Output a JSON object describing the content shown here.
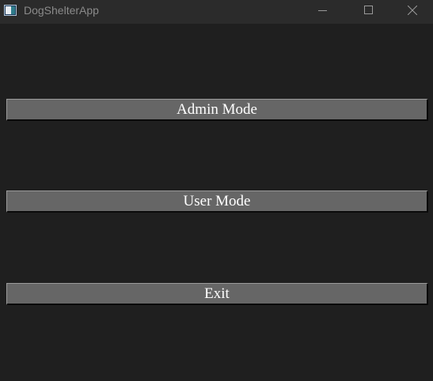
{
  "window": {
    "title": "DogShelterApp",
    "icon": "app-window-icon",
    "controls": [
      "minimize-icon",
      "maximize-icon",
      "close-icon"
    ],
    "background": "#1f1f1f",
    "titlebar_color": "#2b2b2b"
  },
  "menu": {
    "admin_label": "Admin Mode",
    "user_label": "User Mode",
    "exit_label": "Exit",
    "button_color": "#666666"
  }
}
